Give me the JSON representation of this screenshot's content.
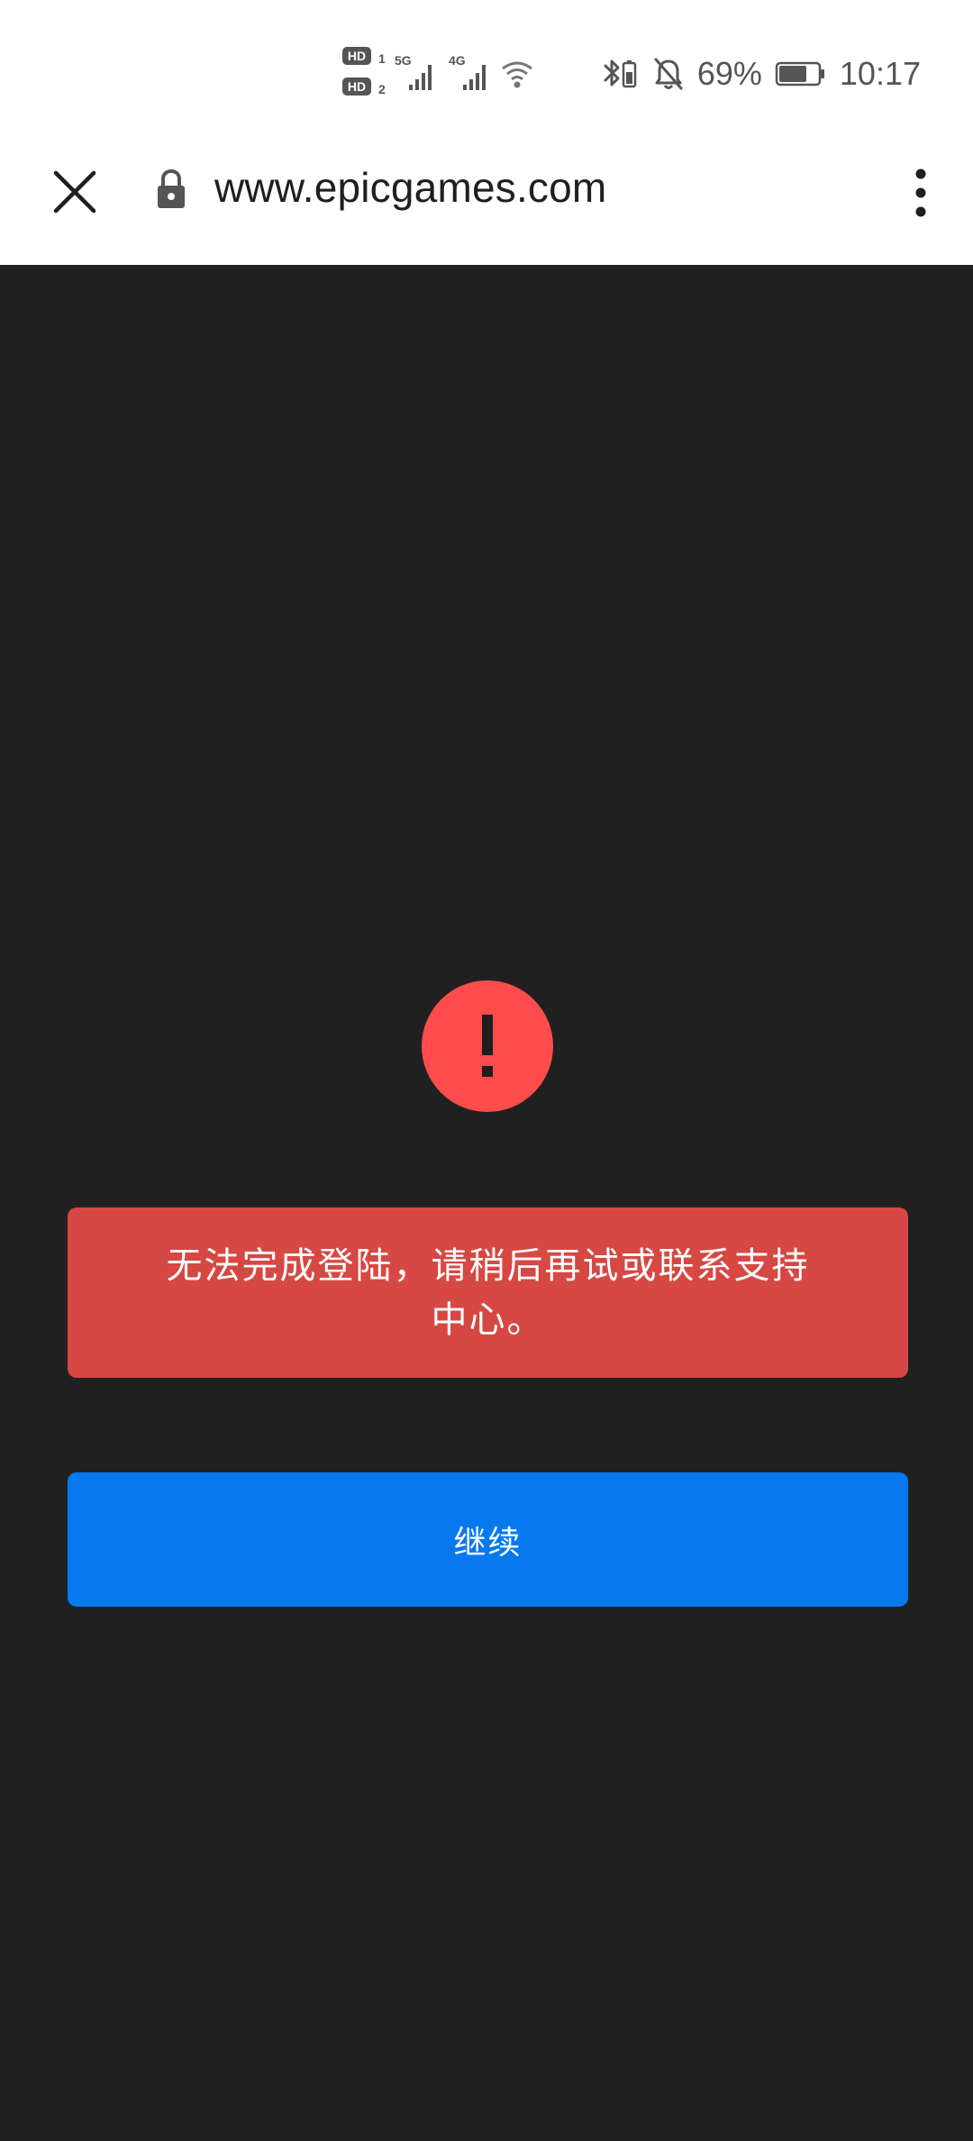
{
  "status_bar": {
    "sim1_label": "HD",
    "sim1_index": "1",
    "sim2_label": "HD",
    "sim2_index": "2",
    "network_5g": "5G",
    "network_4g": "4G",
    "battery_percent": "69%",
    "time": "10:17",
    "icons": [
      "bluetooth-icon",
      "bell-muted-icon",
      "battery-icon",
      "wifi-icon",
      "signal-icon"
    ]
  },
  "browser": {
    "url": "www.epicgames.com",
    "icons": [
      "close-icon",
      "lock-icon",
      "more-vert-icon"
    ]
  },
  "main": {
    "error_message": "无法完成登陆，请稍后再试或联系支持中心。",
    "continue_label": "继续",
    "alert_icon": "exclamation-icon"
  },
  "colors": {
    "page_background": "#202021",
    "alert_circle": "#fe4b4b",
    "error_box": "#d64843",
    "primary_button": "#0679ef"
  }
}
